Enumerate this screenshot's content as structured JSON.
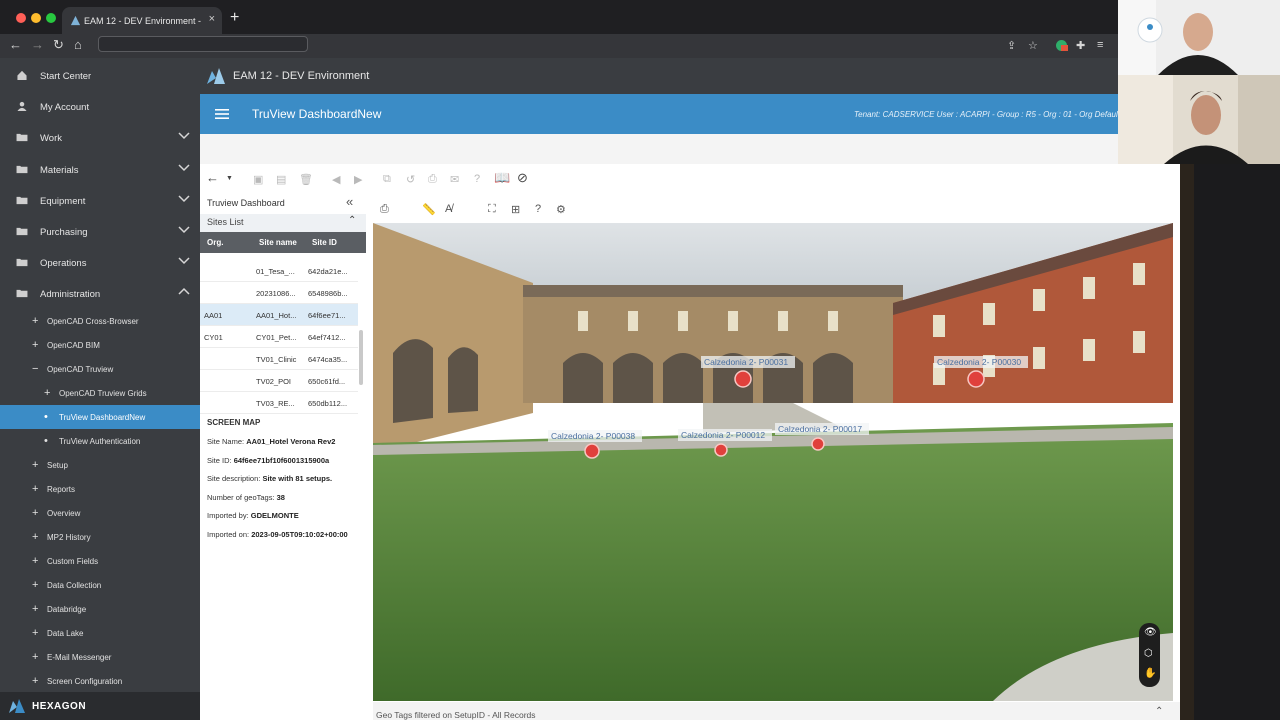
{
  "browser": {
    "tab_title": "EAM 12 - DEV Environment - ",
    "new_tab": "+",
    "close": "×"
  },
  "sidebar": {
    "main_items": [
      {
        "label": "Start Center",
        "icon": "home-icon",
        "chevron": ""
      },
      {
        "label": "My Account",
        "icon": "user-icon",
        "chevron": ""
      },
      {
        "label": "Work",
        "icon": "folder-icon",
        "chevron": "down"
      },
      {
        "label": "Materials",
        "icon": "folder-icon",
        "chevron": "down"
      },
      {
        "label": "Equipment",
        "icon": "folder-icon",
        "chevron": "down"
      },
      {
        "label": "Purchasing",
        "icon": "folder-icon",
        "chevron": "down"
      },
      {
        "label": "Operations",
        "icon": "folder-icon",
        "chevron": "down"
      },
      {
        "label": "Administration",
        "icon": "folder-icon",
        "chevron": "up"
      }
    ],
    "sub_items": [
      {
        "label": "OpenCAD Cross-Browser",
        "marker": "+",
        "level": 1
      },
      {
        "label": "OpenCAD BIM",
        "marker": "+",
        "level": 1
      },
      {
        "label": "OpenCAD Truview",
        "marker": "−",
        "level": 1
      },
      {
        "label": "OpenCAD Truview Grids",
        "marker": "+",
        "level": 2
      },
      {
        "label": "TruView DashboardNew",
        "marker": "•",
        "level": 2,
        "active": true
      },
      {
        "label": "TruView Authentication",
        "marker": "•",
        "level": 2
      },
      {
        "label": "Setup",
        "marker": "+",
        "level": 1
      },
      {
        "label": "Reports",
        "marker": "+",
        "level": 1
      },
      {
        "label": "Overview",
        "marker": "+",
        "level": 1
      },
      {
        "label": "MP2 History",
        "marker": "+",
        "level": 1
      },
      {
        "label": "Custom Fields",
        "marker": "+",
        "level": 1
      },
      {
        "label": "Data Collection",
        "marker": "+",
        "level": 1
      },
      {
        "label": "Databridge",
        "marker": "+",
        "level": 1
      },
      {
        "label": "Data Lake",
        "marker": "+",
        "level": 1
      },
      {
        "label": "E-Mail Messenger",
        "marker": "+",
        "level": 1
      },
      {
        "label": "Screen Configuration",
        "marker": "+",
        "level": 1
      }
    ],
    "brand": "HEXAGON"
  },
  "app_header": {
    "env_title": "EAM 12 - DEV Environment",
    "screen_title": "TruView DashboardNew",
    "tenant": "Tenant: CADSERVICE User : ACARPI - Group : R5 - Org : 01 - Org Default"
  },
  "panel": {
    "title": "Truview Dashboard",
    "sites_list": "Sites List",
    "columns": [
      "Org.",
      "Site name",
      "Site ID"
    ],
    "rows": [
      {
        "org": "",
        "name": "01_Tesa_...",
        "id": "642da21e..."
      },
      {
        "org": "",
        "name": "20231086...",
        "id": "6548986b..."
      },
      {
        "org": "AA01",
        "name": "AA01_Hot...",
        "id": "64f6ee71...",
        "selected": true
      },
      {
        "org": "CY01",
        "name": "CY01_Pet...",
        "id": "64ef7412..."
      },
      {
        "org": "",
        "name": "TV01_Clinic",
        "id": "6474ca35..."
      },
      {
        "org": "",
        "name": "TV02_POI",
        "id": "650c61fd..."
      },
      {
        "org": "",
        "name": "TV03_RE...",
        "id": "650db112..."
      }
    ],
    "screen_map": "SCREEN MAP",
    "info": [
      {
        "label": "Site Name:",
        "value": "AA01_Hotel Verona Rev2"
      },
      {
        "label": "Site ID:",
        "value": "64f6ee71bf10f6001315900a"
      },
      {
        "label": "Site description:",
        "value": "Site with 81 setups."
      },
      {
        "label": "Number of geoTags:",
        "value": "38"
      },
      {
        "label": "Imported by:",
        "value": "GDELMONTE"
      },
      {
        "label": "Imported on:",
        "value": "2023-09-05T09:10:02+00:00"
      }
    ]
  },
  "viewer": {
    "geotags": [
      {
        "label": "Calzedonia 2- P00031"
      },
      {
        "label": "Calzedonia 2- P00030"
      },
      {
        "label": "Calzedonia 2- P00038"
      },
      {
        "label": "Calzedonia 2- P00012"
      },
      {
        "label": "Calzedonia 2- P00017"
      }
    ],
    "status": "Geo Tags filtered on SetupID - All Records"
  },
  "colors": {
    "accent_blue": "#3b8cc6",
    "sidebar_bg": "#3a3d41",
    "geotag_red": "#e0403c"
  }
}
